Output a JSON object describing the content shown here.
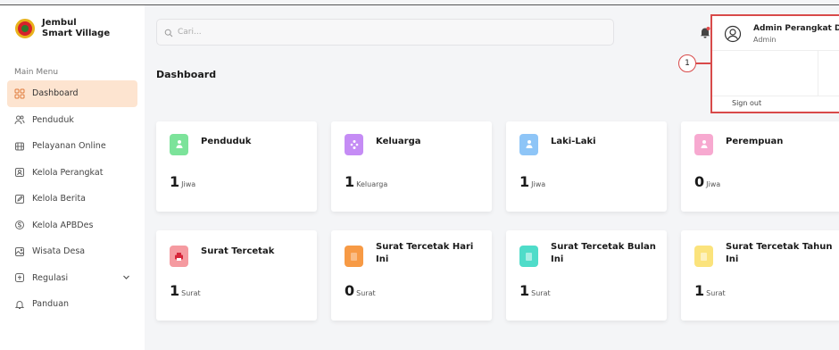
{
  "brand": {
    "name_line1": "Jembul",
    "name_line2": "Smart Village"
  },
  "sidebar": {
    "menu_label": "Main Menu",
    "items": [
      {
        "label": "Dashboard",
        "icon": "grid-icon",
        "active": true
      },
      {
        "label": "Penduduk",
        "icon": "users-icon"
      },
      {
        "label": "Pelayanan Online",
        "icon": "service-icon"
      },
      {
        "label": "Kelola Perangkat",
        "icon": "id-card-icon"
      },
      {
        "label": "Kelola Berita",
        "icon": "pencil-icon"
      },
      {
        "label": "Kelola APBDes",
        "icon": "money-icon"
      },
      {
        "label": "Wisata Desa",
        "icon": "image-icon"
      },
      {
        "label": "Regulasi",
        "icon": "book-icon",
        "has_submenu": true
      },
      {
        "label": "Panduan",
        "icon": "bell-icon"
      }
    ]
  },
  "search": {
    "placeholder": "Cari..."
  },
  "page": {
    "title": "Dashboard"
  },
  "user_menu": {
    "name": "Admin Perangkat Desa",
    "role": "Admin",
    "signout": "Sign out"
  },
  "callout": {
    "number": "1"
  },
  "cards": [
    {
      "title": "Penduduk",
      "value": "1",
      "unit": "Jiwa",
      "color": "#7ce39a"
    },
    {
      "title": "Keluarga",
      "value": "1",
      "unit": "Keluarga",
      "color": "#c58cf5"
    },
    {
      "title": "Laki-Laki",
      "value": "1",
      "unit": "Jiwa",
      "color": "#8ec5f7"
    },
    {
      "title": "Perempuan",
      "value": "0",
      "unit": "Jiwa",
      "color": "#f7a9d0"
    },
    {
      "title": "Surat Tercetak",
      "value": "1",
      "unit": "Surat",
      "color": "#f59aa0"
    },
    {
      "title": "Surat Tercetak Hari Ini",
      "value": "0",
      "unit": "Surat",
      "color": "#f79a45"
    },
    {
      "title": "Surat Tercetak Bulan Ini",
      "value": "1",
      "unit": "Surat",
      "color": "#4fdcc9"
    },
    {
      "title": "Surat Tercetak Tahun Ini",
      "value": "1",
      "unit": "Surat",
      "color": "#fbe37c"
    }
  ]
}
